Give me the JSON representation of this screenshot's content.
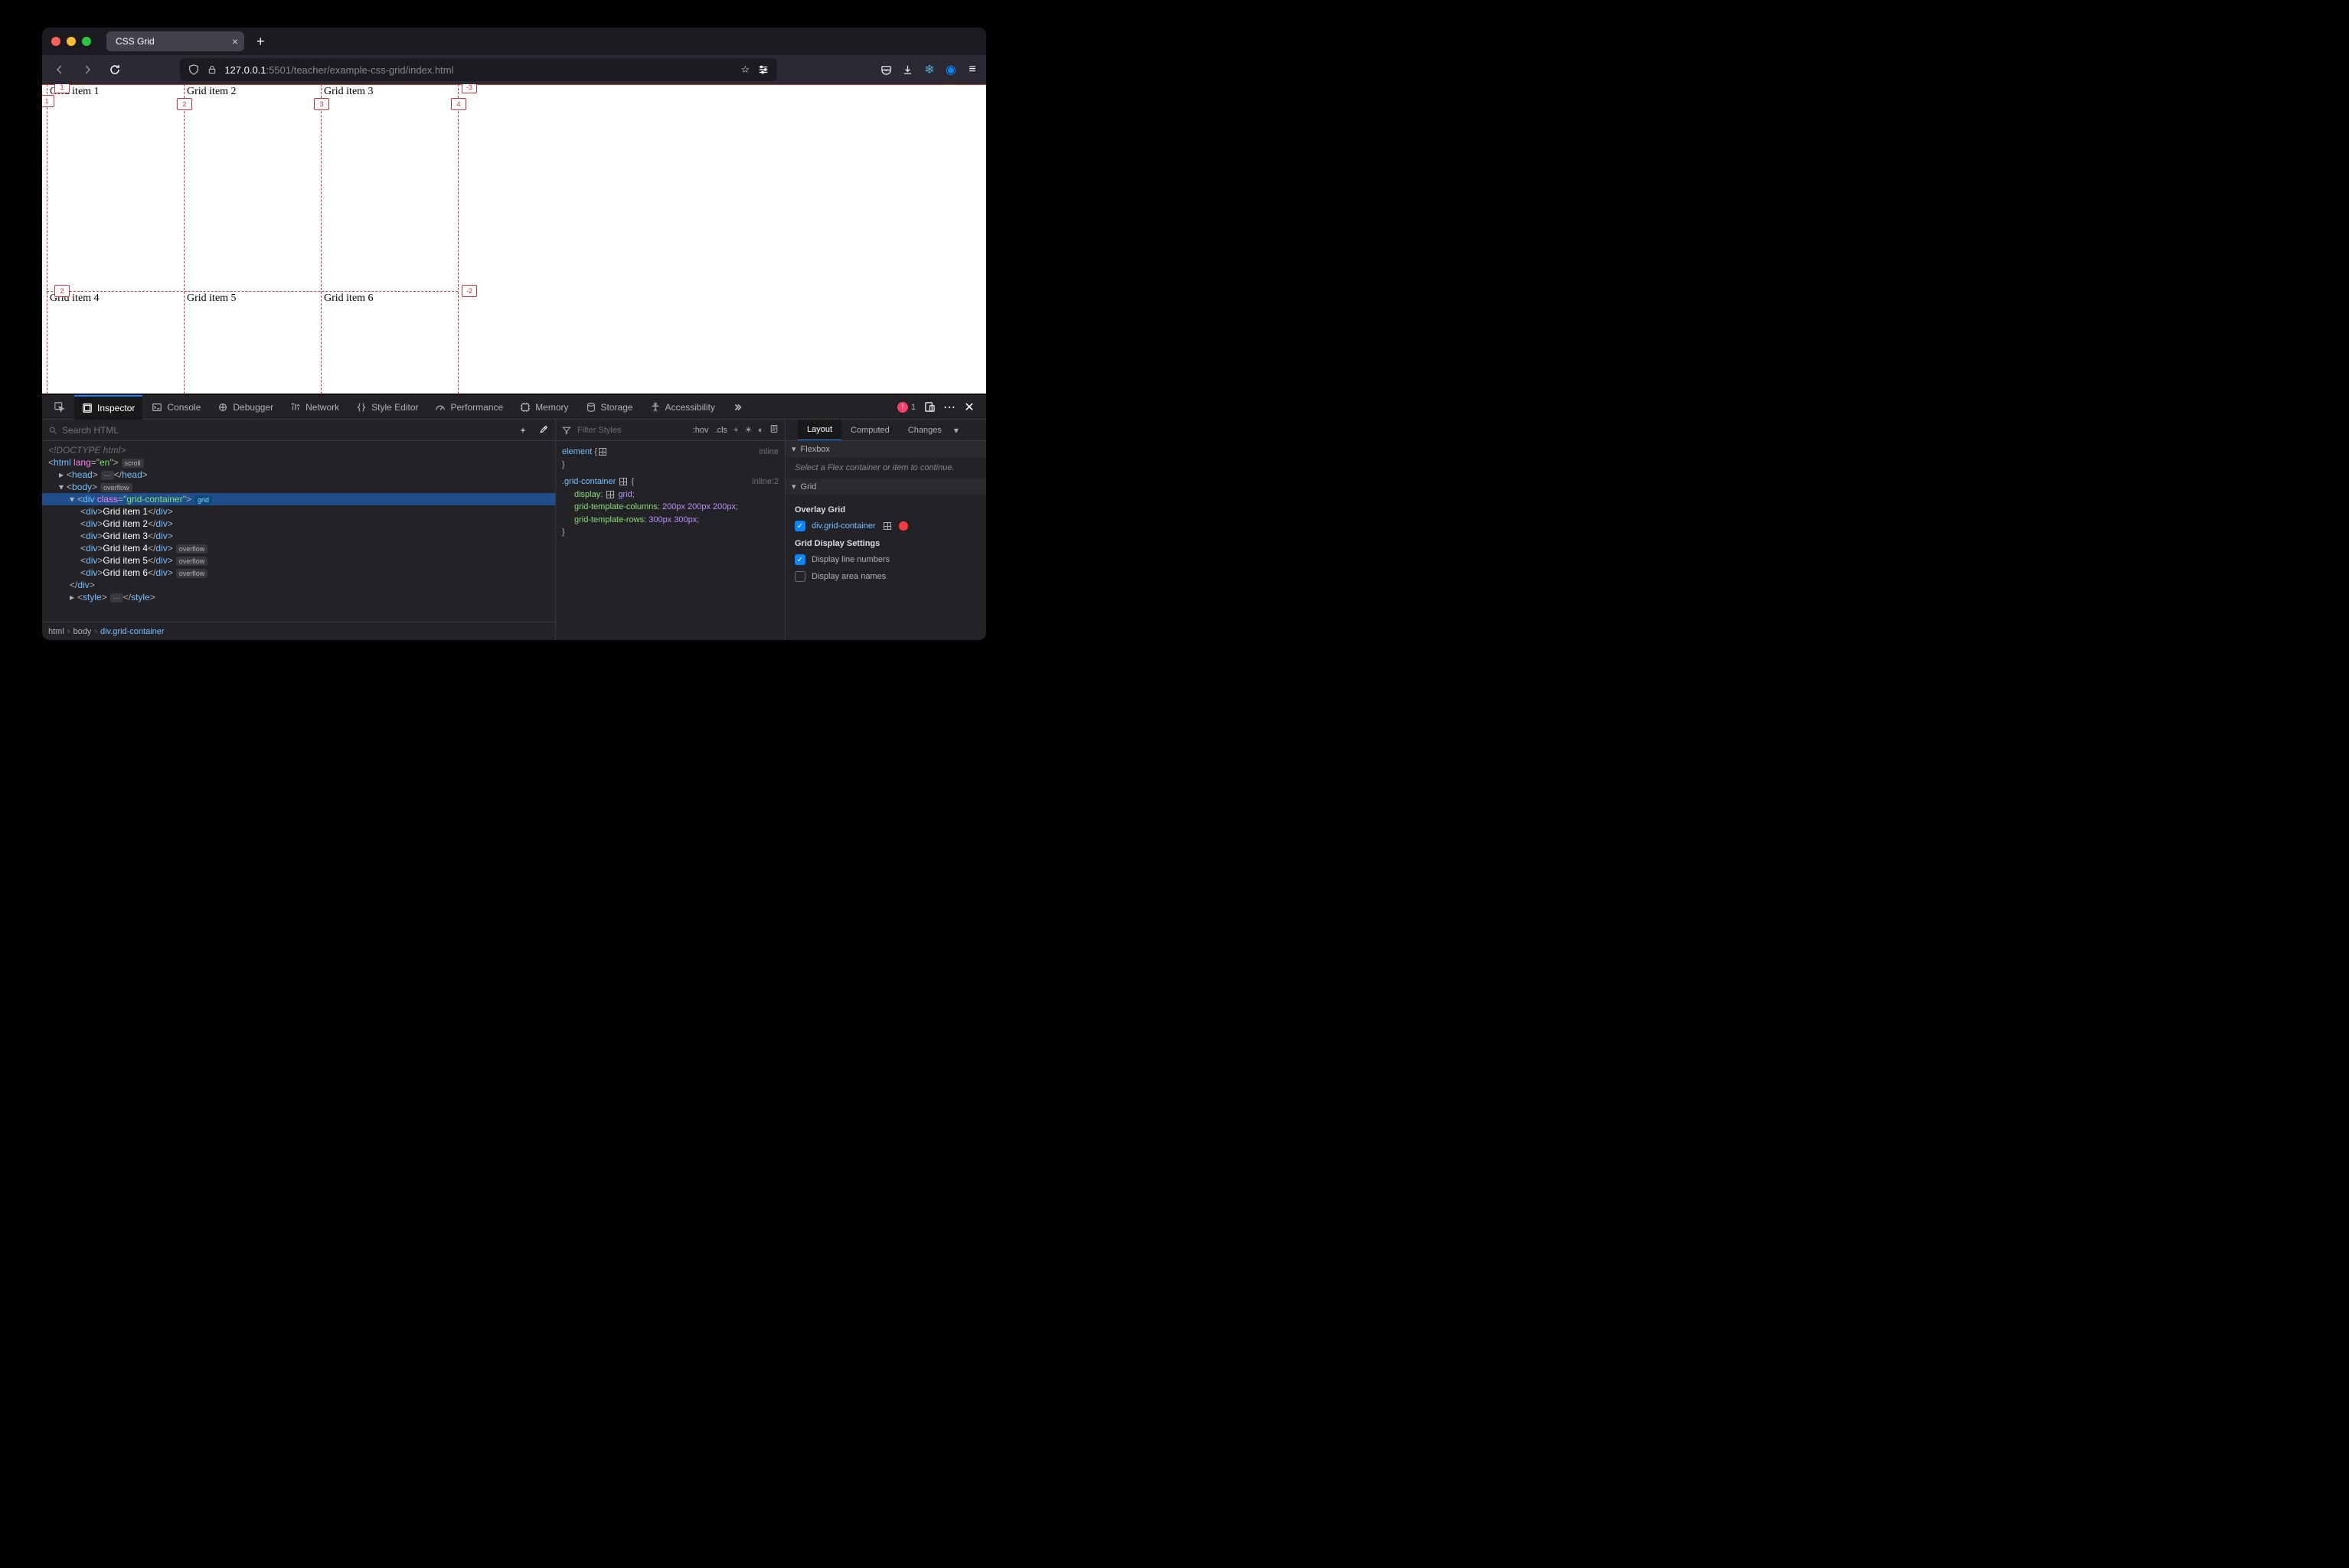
{
  "browser": {
    "tab_title": "CSS Grid",
    "url_host": "127.0.0.1",
    "url_port": ":5501",
    "url_path": "/teacher/example-css-grid/index.html"
  },
  "page": {
    "grid_items": [
      "Grid item 1",
      "Grid item 2",
      "Grid item 3",
      "Grid item 4",
      "Grid item 5",
      "Grid item 6"
    ],
    "col_labels_top": [
      "1",
      "2",
      "3",
      "4"
    ],
    "row_labels_left": [
      "1",
      "2"
    ],
    "neg_label_top": "-3",
    "neg_label_mid": "-2"
  },
  "devtools": {
    "tabs": [
      "Inspector",
      "Console",
      "Debugger",
      "Network",
      "Style Editor",
      "Performance",
      "Memory",
      "Storage",
      "Accessibility"
    ],
    "error_count": "1",
    "search_placeholder": "Search HTML",
    "html_tree": {
      "doctype": "<!DOCTYPE html>",
      "html_open": "html",
      "html_lang_attr": "lang",
      "html_lang_val": "\"en\"",
      "scroll_badge": "scroll",
      "head": "head",
      "body": "body",
      "overflow_badge": "overflow",
      "grid_container_tag": "div",
      "grid_container_attr": "class",
      "grid_container_val": "\"grid-container\"",
      "grid_badge": "grid",
      "children": [
        {
          "tag": "div",
          "text": "Grid item 1",
          "overflow": false
        },
        {
          "tag": "div",
          "text": "Grid item 2",
          "overflow": false
        },
        {
          "tag": "div",
          "text": "Grid item 3",
          "overflow": false
        },
        {
          "tag": "div",
          "text": "Grid item 4",
          "overflow": true
        },
        {
          "tag": "div",
          "text": "Grid item 5",
          "overflow": true
        },
        {
          "tag": "div",
          "text": "Grid item 6",
          "overflow": true
        }
      ],
      "style_tag": "style"
    },
    "breadcrumbs": [
      "html",
      "body",
      "div.grid-container"
    ],
    "styles": {
      "filter_placeholder": "Filter Styles",
      "hov": ":hov",
      "cls": ".cls",
      "element_sel": "element",
      "element_src": "inline",
      "rule_sel": ".grid-container",
      "rule_src": "inline:2",
      "props": [
        {
          "name": "display",
          "value_prefix": "grid",
          "grid_icon": true
        },
        {
          "name": "grid-template-columns",
          "value": "200px 200px 200px"
        },
        {
          "name": "grid-template-rows",
          "value": "300px 300px"
        }
      ]
    },
    "layout": {
      "tabs": [
        "Layout",
        "Computed",
        "Changes"
      ],
      "flexbox_hdr": "Flexbox",
      "flexbox_empty": "Select a Flex container or item to continue.",
      "grid_hdr": "Grid",
      "overlay_hdr": "Overlay Grid",
      "overlay_item": "div.grid-container",
      "overlay_color": "#ff3b3b",
      "settings_hdr": "Grid Display Settings",
      "opt_line_numbers": "Display line numbers",
      "opt_area_names": "Display area names"
    }
  }
}
